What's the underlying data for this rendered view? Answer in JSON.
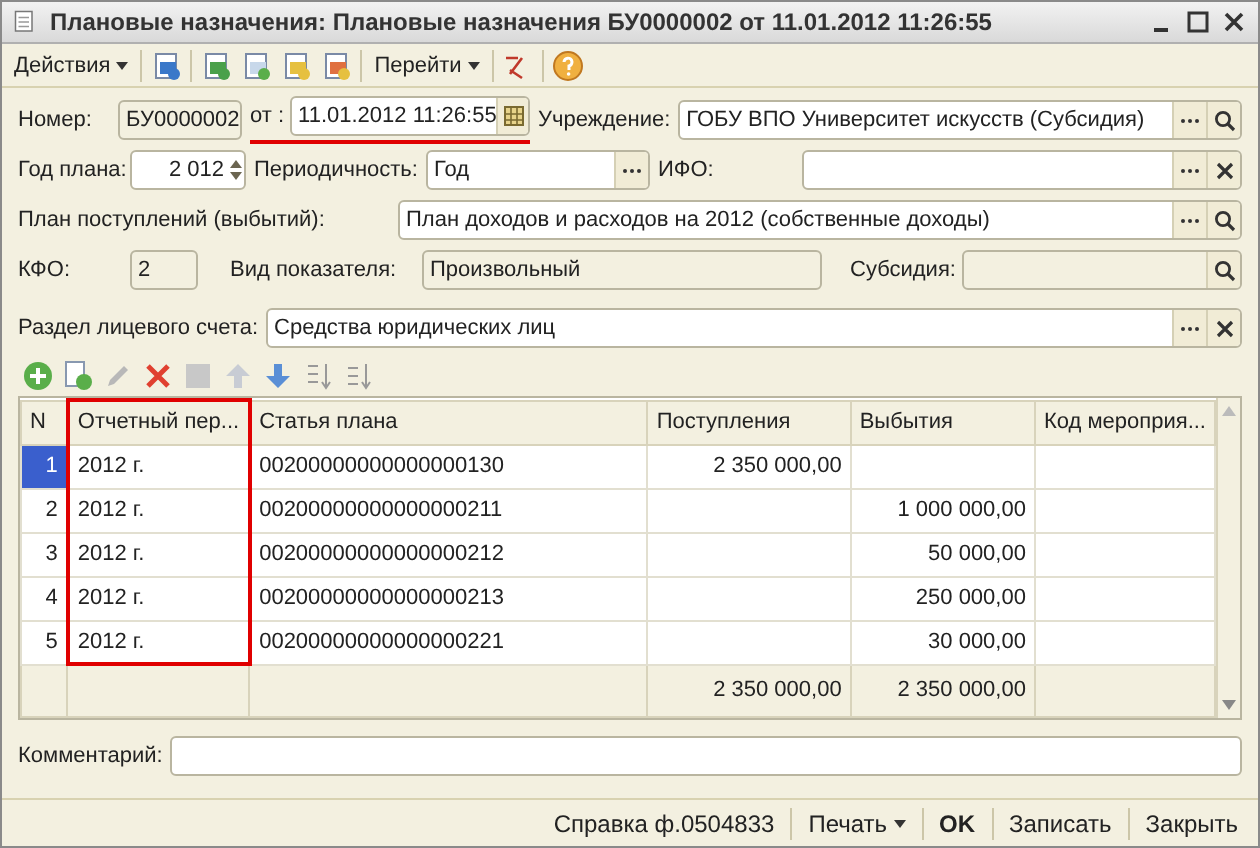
{
  "window": {
    "title": "Плановые назначения: Плановые назначения БУ0000002 от 11.01.2012 11:26:55"
  },
  "toolbar": {
    "actions_menu": "Действия",
    "goto_menu": "Перейти"
  },
  "form": {
    "number": {
      "label": "Номер:",
      "value": "БУ0000002"
    },
    "date": {
      "label": "от :",
      "value": "11.01.2012 11:26:55",
      "highlighted": true
    },
    "institution": {
      "label": "Учреждение:",
      "value": "ГОБУ ВПО Университет искусств (Субсидия)"
    },
    "plan_year": {
      "label": "Год плана:",
      "value": "2 012"
    },
    "periodicity": {
      "label": "Периодичность:",
      "value": "Год"
    },
    "ifo": {
      "label": "ИФО:"
    },
    "plan": {
      "label": "План поступлений (выбытий):",
      "value": "План доходов и расходов на 2012 (собственные доходы)"
    },
    "kfo": {
      "label": "КФО:",
      "value": "2"
    },
    "indicator_type": {
      "label": "Вид показателя:",
      "value": "Произвольный"
    },
    "subsidy": {
      "label": "Субсидия:"
    },
    "account_section": {
      "label": "Раздел лицевого счета:",
      "value": "Средства юридических лиц"
    }
  },
  "table": {
    "columns": [
      {
        "label": "N",
        "highlighted": false
      },
      {
        "label": "Отчетный пер...",
        "highlighted": true
      },
      {
        "label": "Статья плана",
        "highlighted": false
      },
      {
        "label": "Поступления",
        "highlighted": false
      },
      {
        "label": "Выбытия",
        "highlighted": false
      },
      {
        "label": "Код мероприя...",
        "highlighted": false
      }
    ],
    "rows": [
      {
        "cells": [
          "1",
          "2012 г.",
          "00200000000000000130",
          "2 350 000,00",
          "",
          ""
        ],
        "selected": true
      },
      {
        "cells": [
          "2",
          "2012 г.",
          "00200000000000000211",
          "",
          "1 000 000,00",
          ""
        ],
        "selected": false
      },
      {
        "cells": [
          "3",
          "2012 г.",
          "00200000000000000212",
          "",
          "50 000,00",
          ""
        ],
        "selected": false
      },
      {
        "cells": [
          "4",
          "2012 г.",
          "00200000000000000213",
          "",
          "250 000,00",
          ""
        ],
        "selected": false
      },
      {
        "cells": [
          "5",
          "2012 г.",
          "00200000000000000221",
          "",
          "30 000,00",
          ""
        ],
        "selected": false
      }
    ],
    "totals": {
      "receipts": "2 350 000,00",
      "disbursements": "2 350 000,00"
    }
  },
  "comment": {
    "label": "Комментарий:"
  },
  "footer": {
    "report": "Справка ф.0504833",
    "print": "Печать",
    "ok": "OK",
    "save": "Записать",
    "close": "Закрыть"
  }
}
